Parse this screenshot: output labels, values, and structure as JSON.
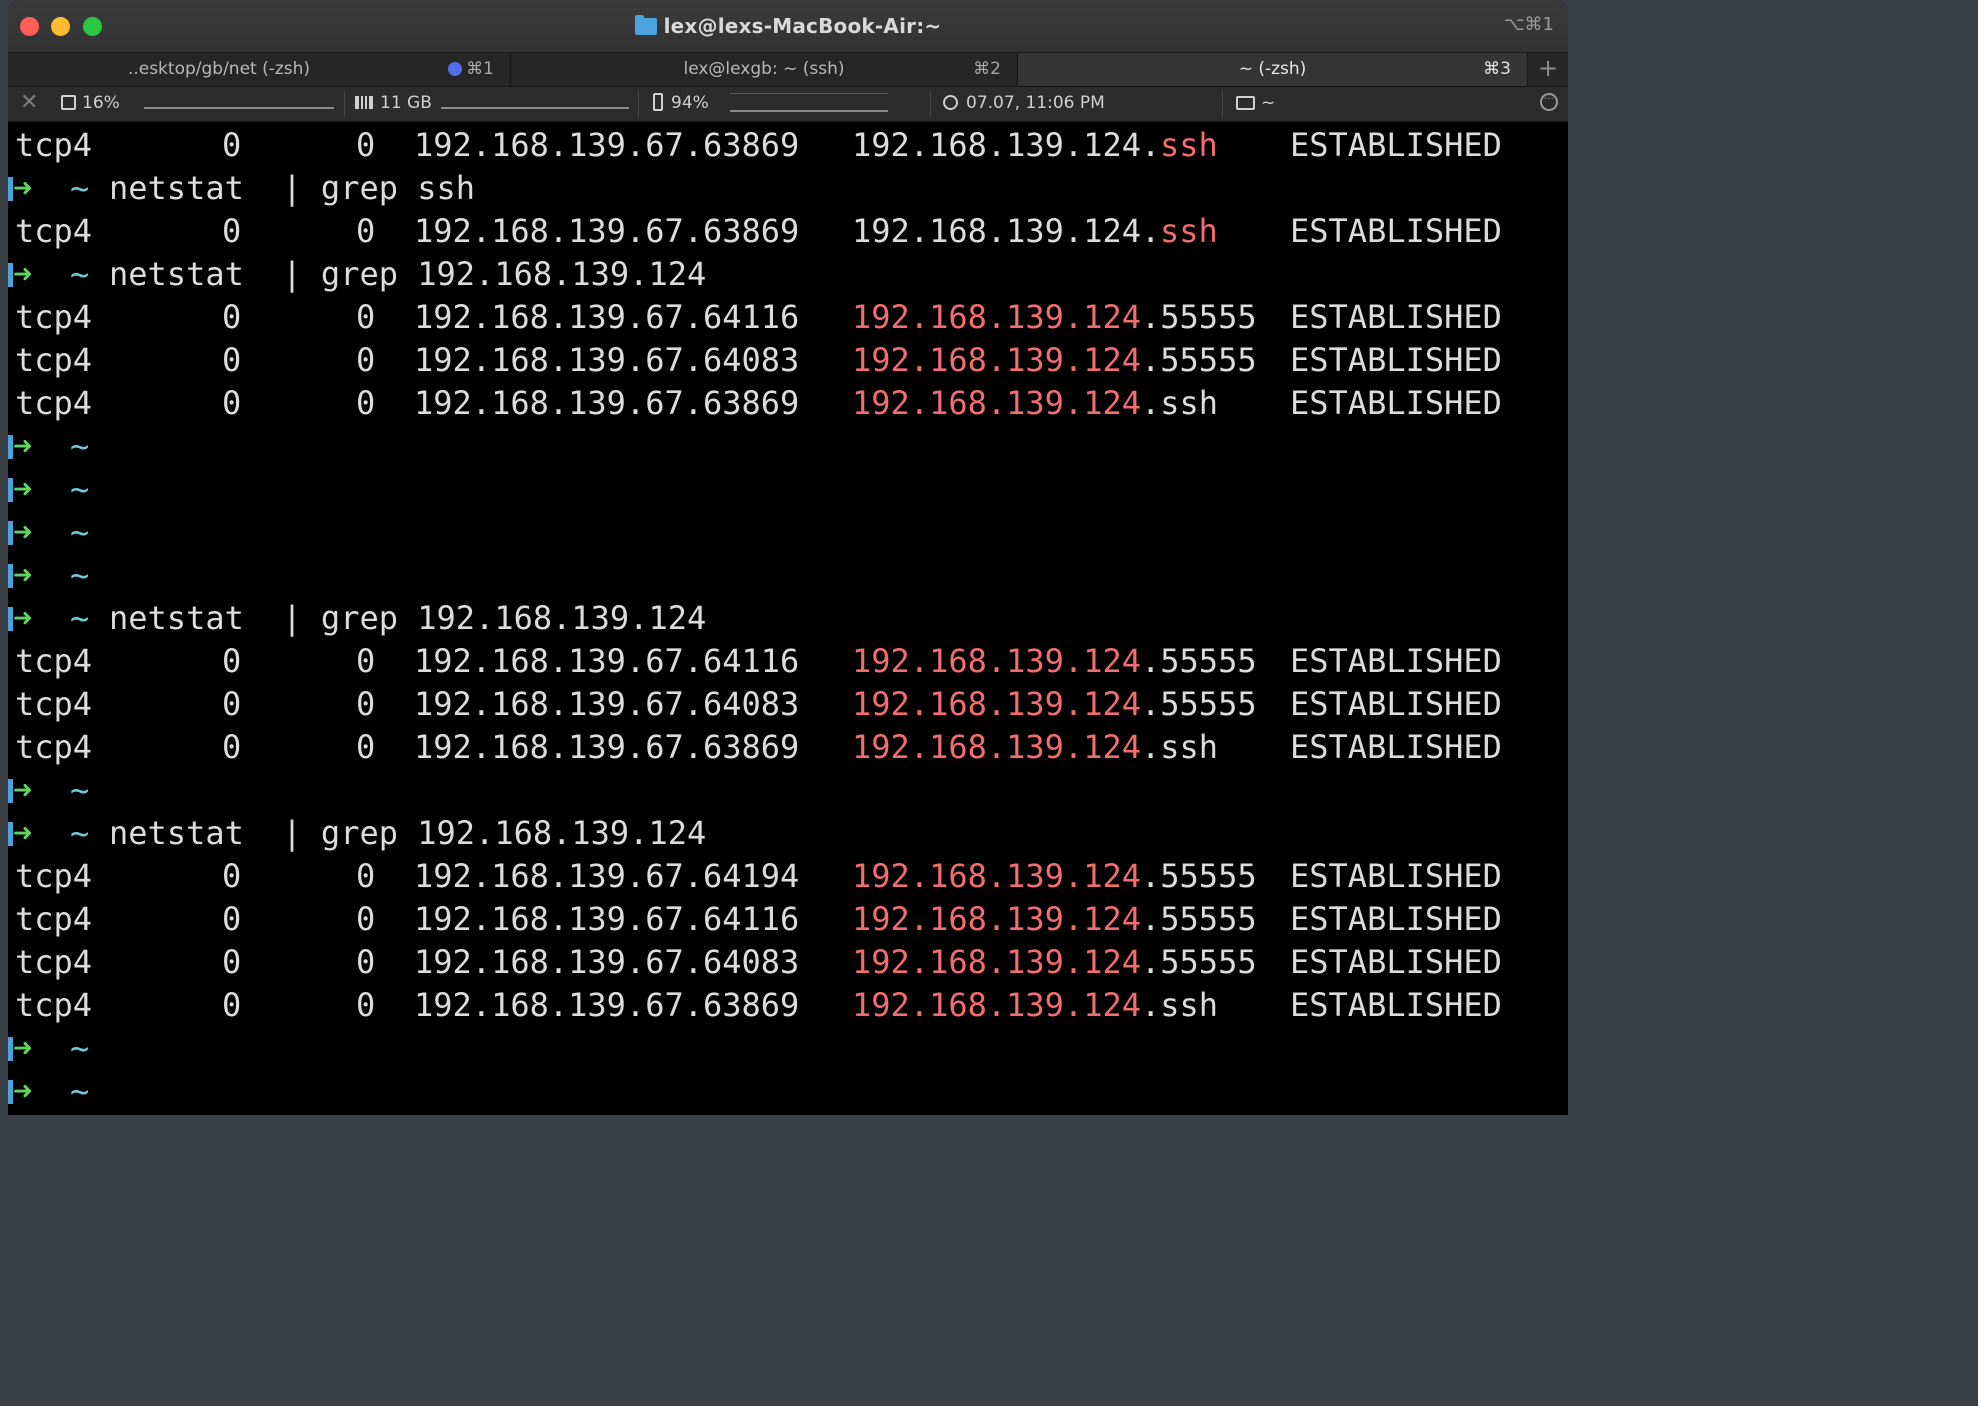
{
  "window": {
    "title": "lex@lexs-MacBook-Air:~",
    "title_shortcut": "⌥⌘1"
  },
  "tabs": [
    {
      "label": "..esktop/gb/net (-zsh)",
      "shortcut": "⌘1",
      "has_dot": true,
      "active": false
    },
    {
      "label": "lex@lexgb: ~ (ssh)",
      "shortcut": "⌘2",
      "has_dot": false,
      "active": false
    },
    {
      "label": "~ (-zsh)",
      "shortcut": "⌘3",
      "has_dot": false,
      "active": true
    }
  ],
  "tab_add_label": "+",
  "status": {
    "close_label": "✕",
    "cpu": "16%",
    "memory": "11 GB",
    "battery": "94%",
    "clock": "07.07, 11:06 PM",
    "directory": "~"
  },
  "terminal": {
    "prompt_symbol": "➜",
    "prompt_dir": "~",
    "lines": [
      {
        "kind": "out",
        "proto": "tcp4",
        "recv": "0",
        "send": "0",
        "local": "192.168.139.67.63869",
        "foreign_a": "192.168.139.124.",
        "foreign_b": "ssh",
        "foreign_red": "b",
        "state": "ESTABLISHED"
      },
      {
        "kind": "prompt",
        "cmd": "netstat  | grep ssh"
      },
      {
        "kind": "out",
        "proto": "tcp4",
        "recv": "0",
        "send": "0",
        "local": "192.168.139.67.63869",
        "foreign_a": "192.168.139.124.",
        "foreign_b": "ssh",
        "foreign_red": "b",
        "state": "ESTABLISHED"
      },
      {
        "kind": "prompt",
        "cmd": "netstat  | grep 192.168.139.124"
      },
      {
        "kind": "out",
        "proto": "tcp4",
        "recv": "0",
        "send": "0",
        "local": "192.168.139.67.64116",
        "foreign_a": "192.168.139.124",
        "foreign_b": ".55555",
        "foreign_red": "a",
        "state": "ESTABLISHED"
      },
      {
        "kind": "out",
        "proto": "tcp4",
        "recv": "0",
        "send": "0",
        "local": "192.168.139.67.64083",
        "foreign_a": "192.168.139.124",
        "foreign_b": ".55555",
        "foreign_red": "a",
        "state": "ESTABLISHED"
      },
      {
        "kind": "out",
        "proto": "tcp4",
        "recv": "0",
        "send": "0",
        "local": "192.168.139.67.63869",
        "foreign_a": "192.168.139.124",
        "foreign_b": ".ssh",
        "foreign_red": "a",
        "state": "ESTABLISHED"
      },
      {
        "kind": "prompt",
        "cmd": ""
      },
      {
        "kind": "prompt",
        "cmd": ""
      },
      {
        "kind": "prompt",
        "cmd": ""
      },
      {
        "kind": "prompt",
        "cmd": ""
      },
      {
        "kind": "prompt",
        "cmd": "netstat  | grep 192.168.139.124"
      },
      {
        "kind": "out",
        "proto": "tcp4",
        "recv": "0",
        "send": "0",
        "local": "192.168.139.67.64116",
        "foreign_a": "192.168.139.124",
        "foreign_b": ".55555",
        "foreign_red": "a",
        "state": "ESTABLISHED"
      },
      {
        "kind": "out",
        "proto": "tcp4",
        "recv": "0",
        "send": "0",
        "local": "192.168.139.67.64083",
        "foreign_a": "192.168.139.124",
        "foreign_b": ".55555",
        "foreign_red": "a",
        "state": "ESTABLISHED"
      },
      {
        "kind": "out",
        "proto": "tcp4",
        "recv": "0",
        "send": "0",
        "local": "192.168.139.67.63869",
        "foreign_a": "192.168.139.124",
        "foreign_b": ".ssh",
        "foreign_red": "a",
        "state": "ESTABLISHED"
      },
      {
        "kind": "prompt",
        "cmd": ""
      },
      {
        "kind": "prompt",
        "cmd": "netstat  | grep 192.168.139.124"
      },
      {
        "kind": "out",
        "proto": "tcp4",
        "recv": "0",
        "send": "0",
        "local": "192.168.139.67.64194",
        "foreign_a": "192.168.139.124",
        "foreign_b": ".55555",
        "foreign_red": "a",
        "state": "ESTABLISHED"
      },
      {
        "kind": "out",
        "proto": "tcp4",
        "recv": "0",
        "send": "0",
        "local": "192.168.139.67.64116",
        "foreign_a": "192.168.139.124",
        "foreign_b": ".55555",
        "foreign_red": "a",
        "state": "ESTABLISHED"
      },
      {
        "kind": "out",
        "proto": "tcp4",
        "recv": "0",
        "send": "0",
        "local": "192.168.139.67.64083",
        "foreign_a": "192.168.139.124",
        "foreign_b": ".55555",
        "foreign_red": "a",
        "state": "ESTABLISHED"
      },
      {
        "kind": "out",
        "proto": "tcp4",
        "recv": "0",
        "send": "0",
        "local": "192.168.139.67.63869",
        "foreign_a": "192.168.139.124",
        "foreign_b": ".ssh",
        "foreign_red": "a",
        "state": "ESTABLISHED"
      },
      {
        "kind": "prompt",
        "cmd": ""
      },
      {
        "kind": "prompt",
        "cmd": ""
      }
    ]
  }
}
